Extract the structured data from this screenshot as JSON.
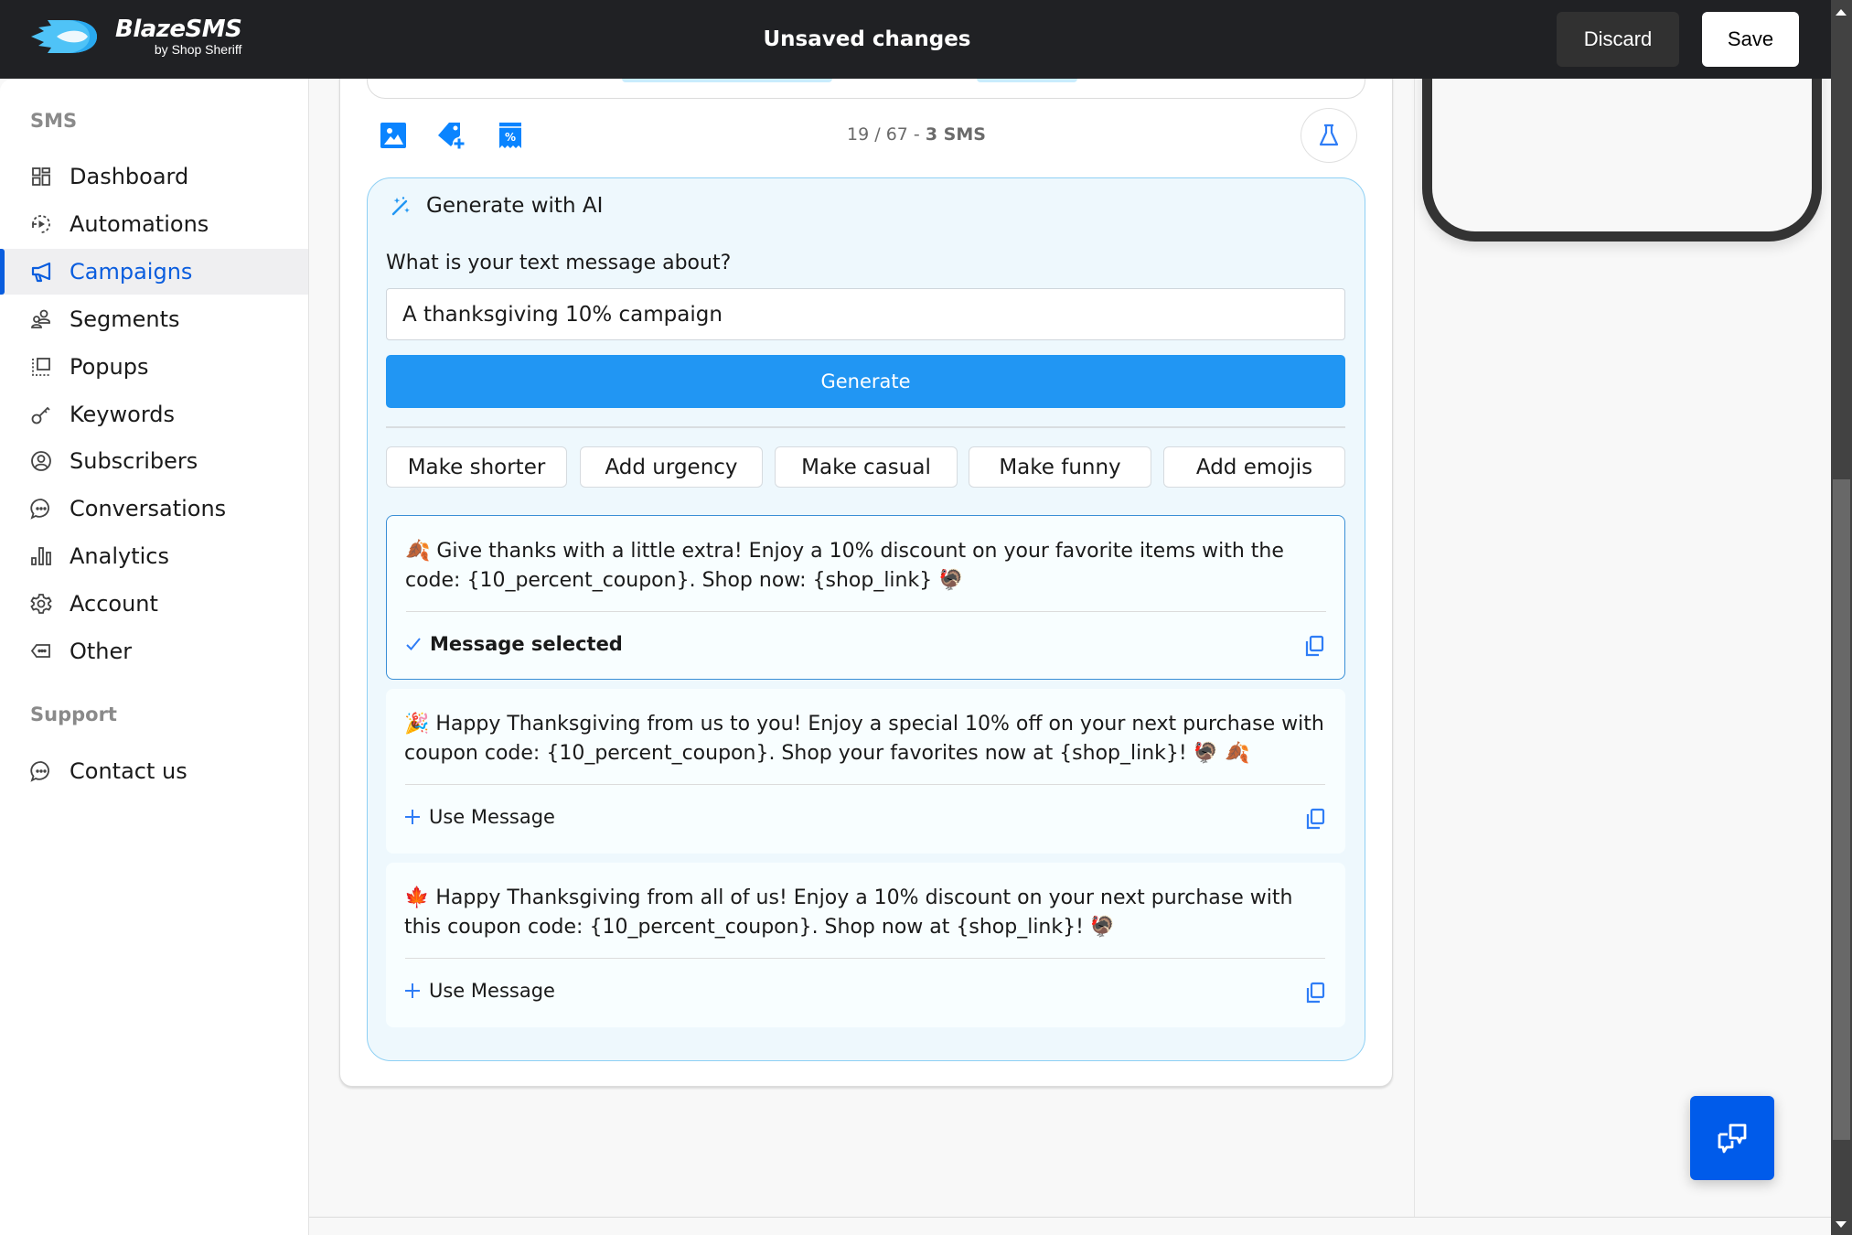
{
  "header": {
    "brand_name": "BlazeSMS",
    "brand_sub": "by Shop Sheriff",
    "title": "Unsaved changes",
    "discard_label": "Discard",
    "save_label": "Save"
  },
  "sidebar": {
    "section_sms": "SMS",
    "items": [
      {
        "label": "Dashboard",
        "icon": "dashboard-icon"
      },
      {
        "label": "Automations",
        "icon": "automations-icon"
      },
      {
        "label": "Campaigns",
        "icon": "megaphone-icon",
        "active": true
      },
      {
        "label": "Segments",
        "icon": "segments-icon"
      },
      {
        "label": "Popups",
        "icon": "popups-icon"
      },
      {
        "label": "Keywords",
        "icon": "key-icon"
      },
      {
        "label": "Subscribers",
        "icon": "user-circle-icon"
      },
      {
        "label": "Conversations",
        "icon": "chat-bubble-icon"
      },
      {
        "label": "Analytics",
        "icon": "bar-chart-icon"
      },
      {
        "label": "Account",
        "icon": "gear-icon"
      },
      {
        "label": "Other",
        "icon": "tag-icon"
      }
    ],
    "section_support": "Support",
    "support_items": [
      {
        "label": "Contact us",
        "icon": "chat-bubble-icon"
      }
    ]
  },
  "composer": {
    "toolbar_icons": [
      "image-icon",
      "tag-plus-icon",
      "discount-coupon-icon"
    ],
    "counter_chars": "19 / 67",
    "counter_sep": " - ",
    "counter_sms": "3 SMS",
    "test_icon": "flask-icon"
  },
  "ai": {
    "title": "Generate with AI",
    "question": "What is your text message about?",
    "input_value": "A thanksgiving 10% campaign",
    "generate_label": "Generate",
    "refine_options": [
      "Make shorter",
      "Add urgency",
      "Make casual",
      "Make funny",
      "Add emojis"
    ],
    "messages": [
      {
        "text": "🍂 Give thanks with a little extra! Enjoy a 10% discount on your favorite items with the code: {10_percent_coupon}. Shop now: {shop_link} 🦃",
        "action": "Message selected",
        "selected": true
      },
      {
        "text": "🎉 Happy Thanksgiving from us to you! Enjoy a special 10% off on your next purchase with coupon code: {10_percent_coupon}. Shop your favorites now at {shop_link}! 🦃 🍂",
        "action": "Use Message",
        "selected": false
      },
      {
        "text": "🍁 Happy Thanksgiving from all of us! Enjoy a 10% discount on your next purchase with this coupon code: {10_percent_coupon}. Shop now at {shop_link}! 🦃",
        "action": "Use Message",
        "selected": false
      }
    ]
  },
  "colors": {
    "header_bg": "#202124",
    "accent": "#0a5dde",
    "generate_button": "#2196f3",
    "ai_panel_bg": "#eef8fd",
    "chat_button": "#005bea"
  }
}
